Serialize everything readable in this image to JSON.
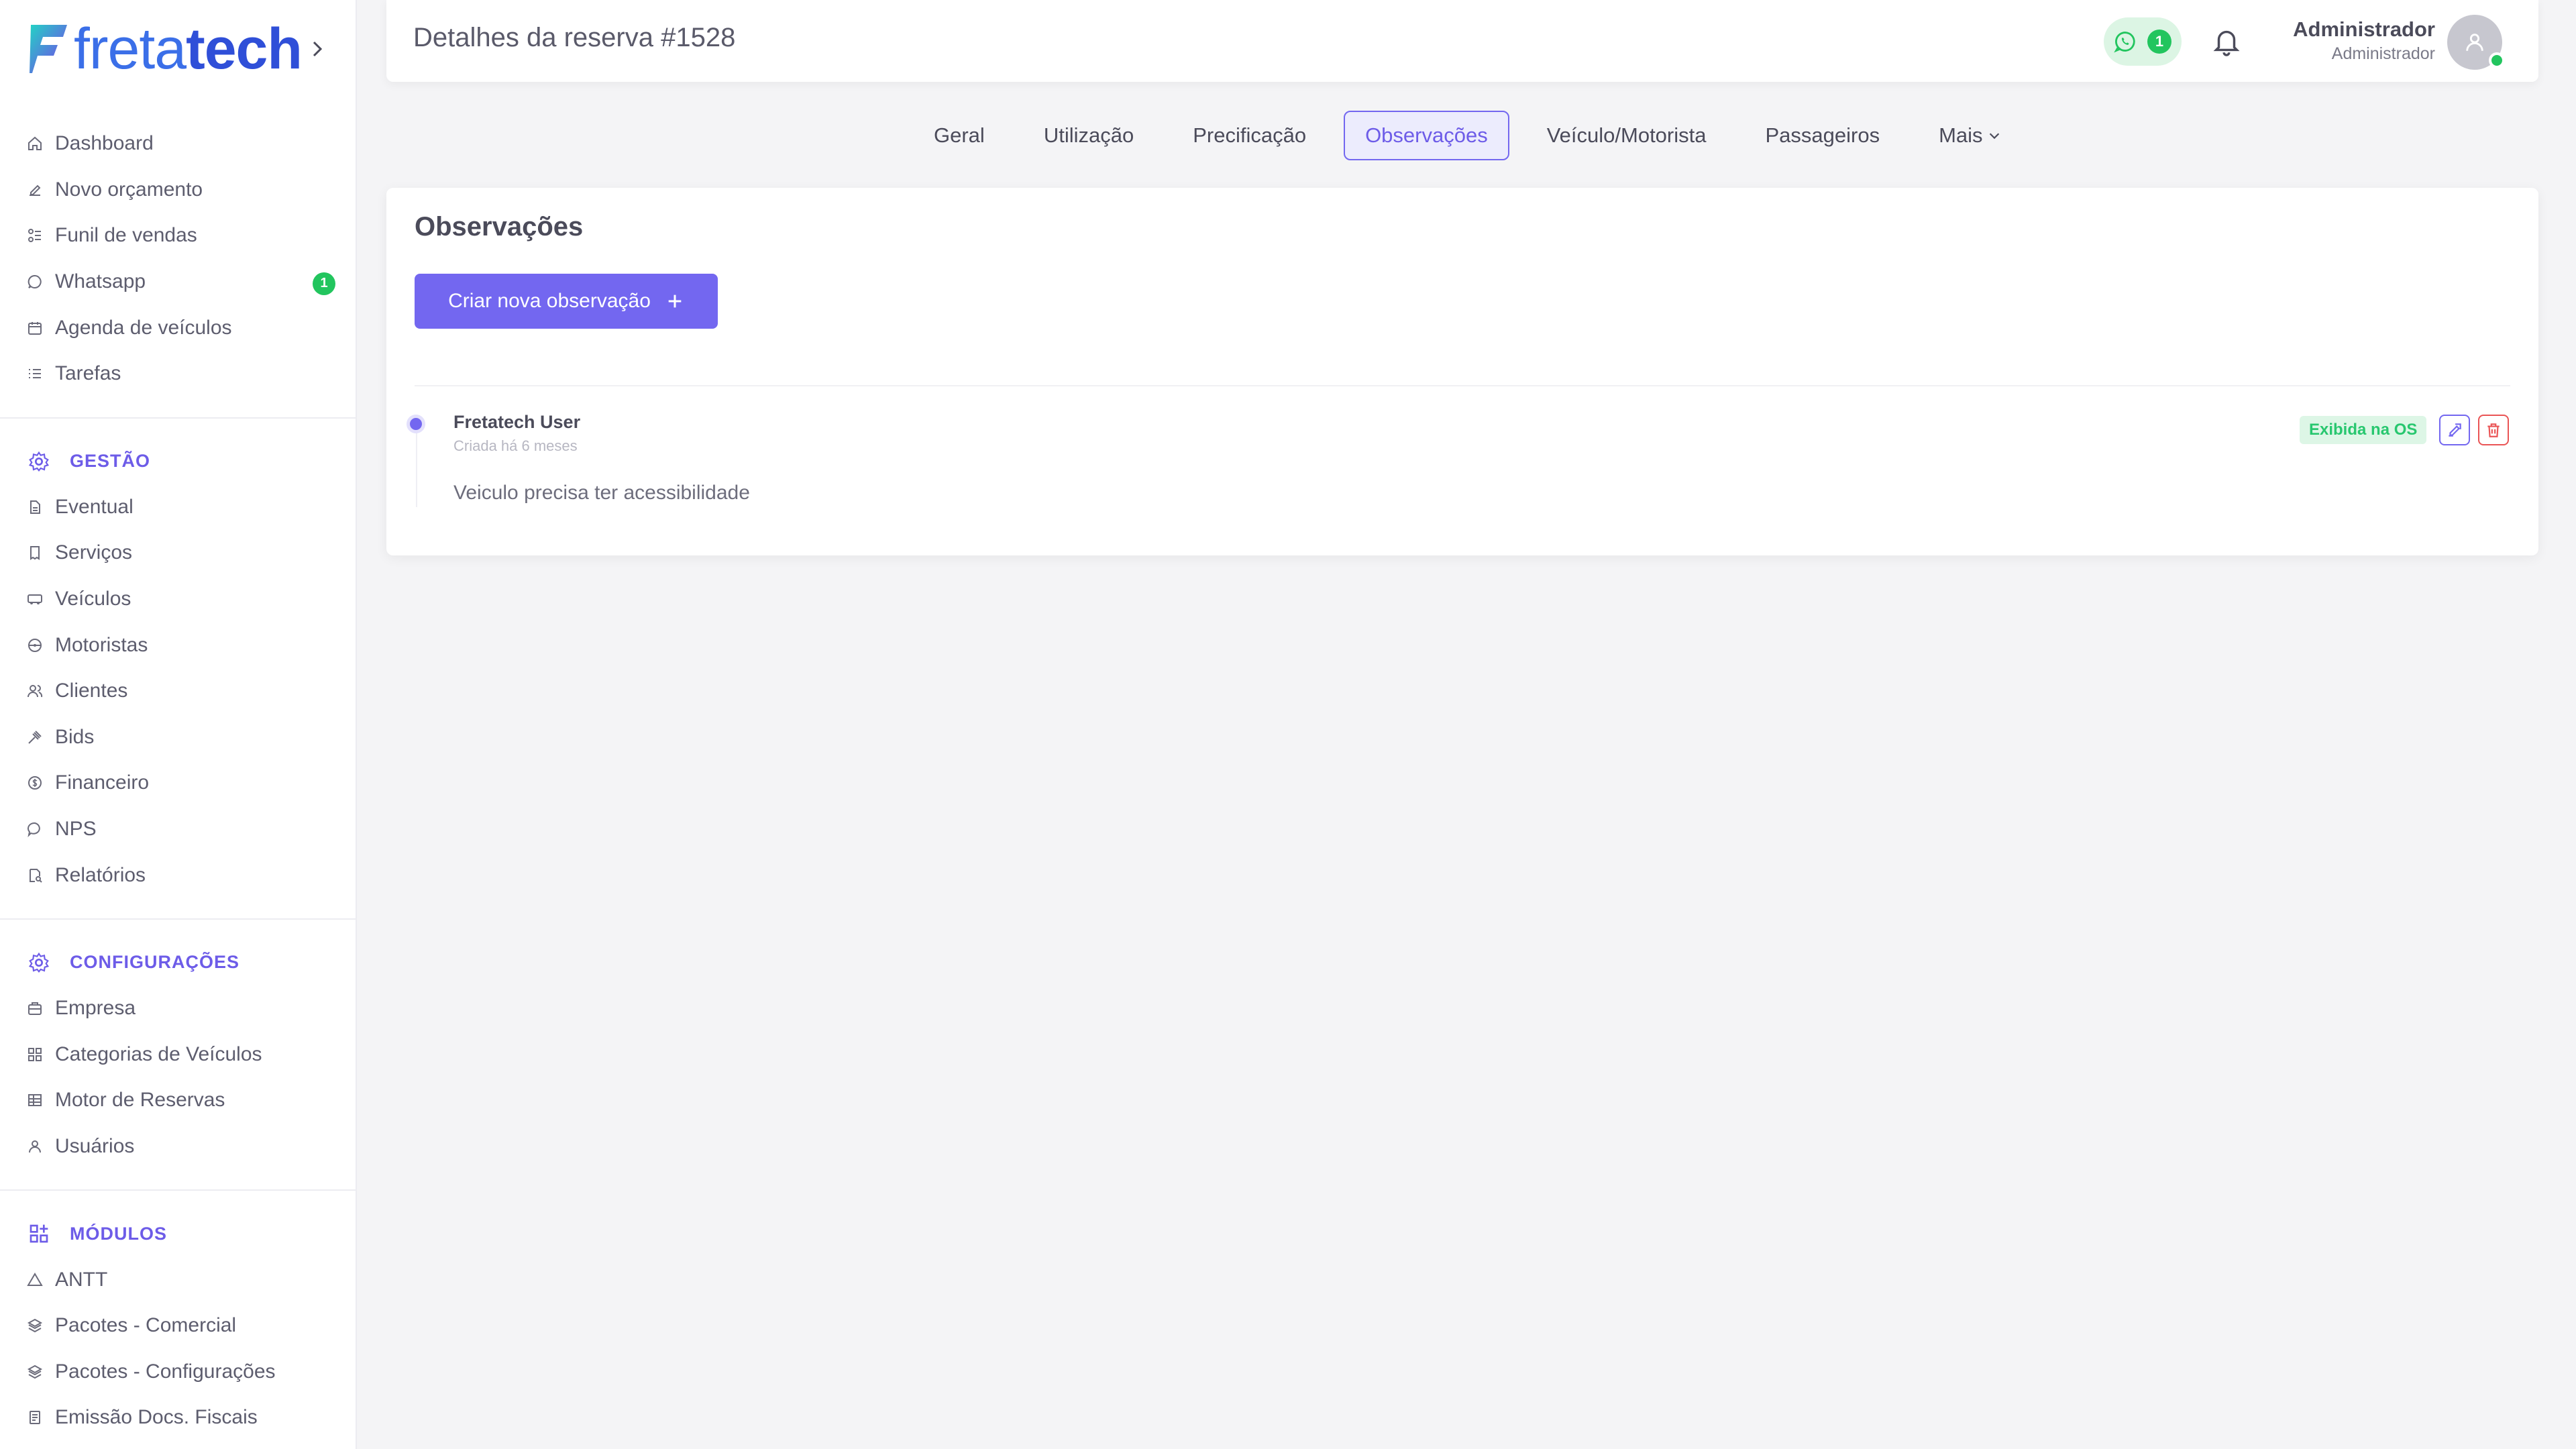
{
  "app": {
    "logo_light": "freta",
    "logo_bold": "tech"
  },
  "sidebar": {
    "main_items": [
      {
        "label": "Dashboard",
        "icon": "home-icon"
      },
      {
        "label": "Novo orçamento",
        "icon": "edit-icon"
      },
      {
        "label": "Funil de vendas",
        "icon": "funnel-icon"
      },
      {
        "label": "Whatsapp",
        "icon": "whatsapp-icon",
        "badge": "1"
      },
      {
        "label": "Agenda de veículos",
        "icon": "calendar-icon"
      },
      {
        "label": "Tarefas",
        "icon": "list-icon"
      }
    ],
    "gestao": {
      "title": "GESTÃO",
      "items": [
        {
          "label": "Eventual",
          "icon": "document-icon"
        },
        {
          "label": "Serviços",
          "icon": "receipt-icon"
        },
        {
          "label": "Veículos",
          "icon": "bus-icon"
        },
        {
          "label": "Motoristas",
          "icon": "steering-wheel-icon"
        },
        {
          "label": "Clientes",
          "icon": "users-icon"
        },
        {
          "label": "Bids",
          "icon": "gavel-icon"
        },
        {
          "label": "Financeiro",
          "icon": "dollar-icon"
        },
        {
          "label": "NPS",
          "icon": "chat-icon"
        },
        {
          "label": "Relatórios",
          "icon": "report-icon"
        }
      ]
    },
    "configuracoes": {
      "title": "CONFIGURAÇÕES",
      "items": [
        {
          "label": "Empresa",
          "icon": "building-icon"
        },
        {
          "label": "Categorias de Veículos",
          "icon": "grid-icon"
        },
        {
          "label": "Motor de Reservas",
          "icon": "table-icon"
        },
        {
          "label": "Usuários",
          "icon": "user-icon"
        }
      ]
    },
    "modulos": {
      "title": "MÓDULOS",
      "items": [
        {
          "label": "ANTT",
          "icon": "triangle-icon"
        },
        {
          "label": "Pacotes - Comercial",
          "icon": "package-icon"
        },
        {
          "label": "Pacotes - Configurações",
          "icon": "package-icon"
        },
        {
          "label": "Emissão Docs. Fiscais",
          "icon": "invoice-icon"
        }
      ]
    }
  },
  "header": {
    "title": "Detalhes da reserva #1528",
    "whatsapp_count": "1",
    "user_name": "Administrador",
    "user_role": "Administrador"
  },
  "tabs": [
    {
      "label": "Geral"
    },
    {
      "label": "Utilização"
    },
    {
      "label": "Precificação"
    },
    {
      "label": "Observações",
      "active": true
    },
    {
      "label": "Veículo/Motorista"
    },
    {
      "label": "Passageiros"
    },
    {
      "label": "Mais"
    }
  ],
  "main": {
    "card_title": "Observações",
    "create_button": "Criar nova observação",
    "observation": {
      "author": "Fretatech User",
      "date": "Criada há 6 meses",
      "text": "Veiculo precisa ter acessibilidade",
      "badge": "Exibida na OS"
    }
  },
  "colors": {
    "accent": "#7367f0",
    "success": "#28c76f",
    "danger": "#ea5455",
    "brand": "#2f4fd8"
  }
}
